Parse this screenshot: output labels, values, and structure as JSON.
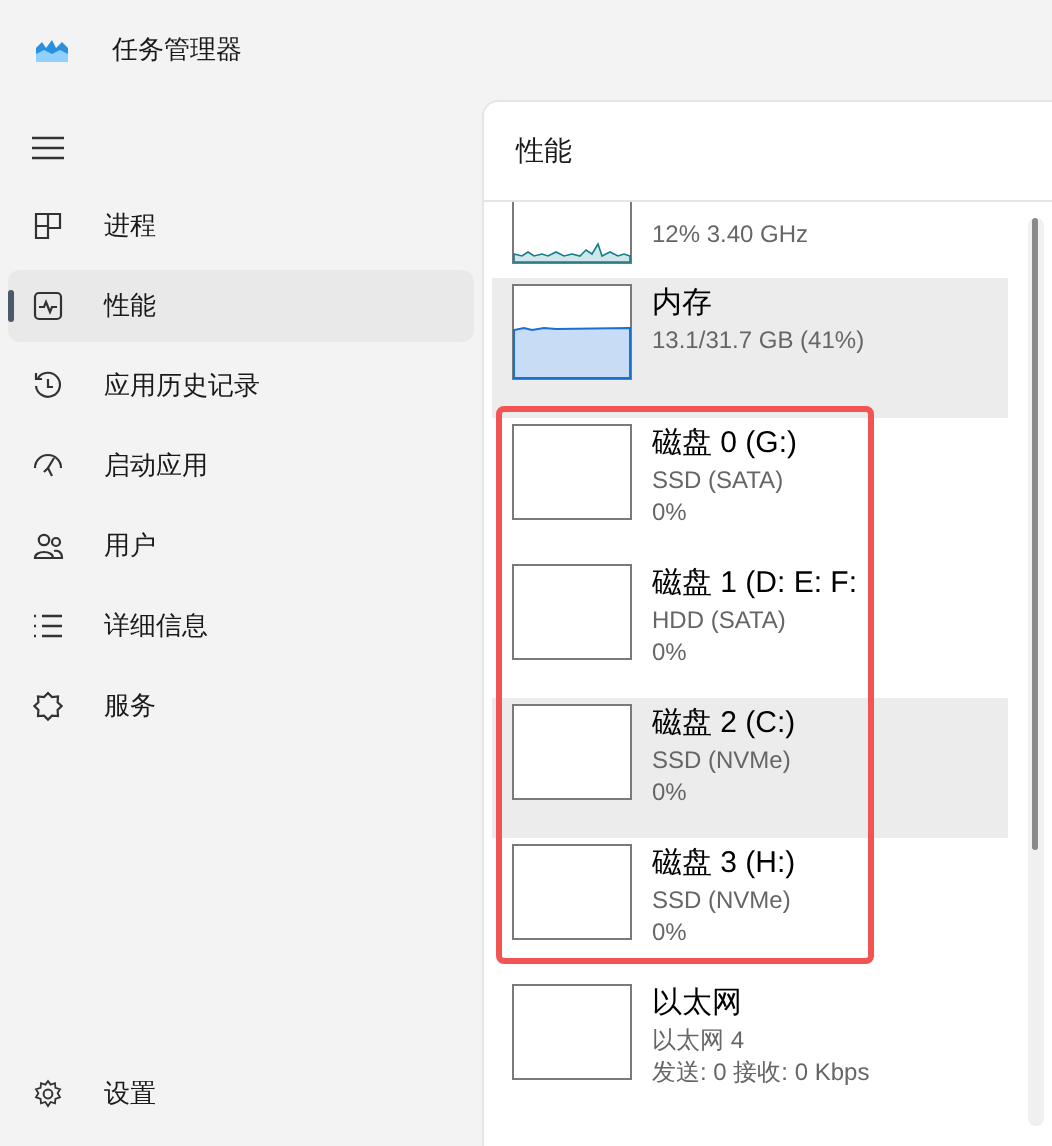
{
  "window": {
    "title": "任务管理器"
  },
  "sidebar": {
    "items": [
      {
        "label": "进程",
        "selected": false
      },
      {
        "label": "性能",
        "selected": true
      },
      {
        "label": "应用历史记录",
        "selected": false
      },
      {
        "label": "启动应用",
        "selected": false
      },
      {
        "label": "用户",
        "selected": false
      },
      {
        "label": "详细信息",
        "selected": false
      },
      {
        "label": "服务",
        "selected": false
      }
    ],
    "settings": {
      "label": "设置"
    }
  },
  "panel": {
    "title": "性能",
    "items": [
      {
        "kind": "cpu",
        "subtitle": "12% 3.40 GHz",
        "highlighted": false
      },
      {
        "kind": "memory",
        "title": "内存",
        "subtitle": "13.1/31.7 GB (41%)",
        "highlighted": true
      },
      {
        "kind": "disk",
        "title": "磁盘 0 (G:)",
        "subtitle": "SSD (SATA)",
        "value": "0%",
        "highlighted": false
      },
      {
        "kind": "disk",
        "title": "磁盘 1 (D: E: F:",
        "subtitle": "HDD (SATA)",
        "value": "0%",
        "highlighted": false
      },
      {
        "kind": "disk",
        "title": "磁盘 2 (C:)",
        "subtitle": "SSD (NVMe)",
        "value": "0%",
        "highlighted": true
      },
      {
        "kind": "disk",
        "title": "磁盘 3 (H:)",
        "subtitle": "SSD (NVMe)",
        "value": "0%",
        "highlighted": false
      },
      {
        "kind": "ethernet",
        "title": "以太网",
        "subtitle": "以太网 4",
        "value": "发送: 0 接收: 0 Kbps",
        "highlighted": false
      }
    ]
  }
}
